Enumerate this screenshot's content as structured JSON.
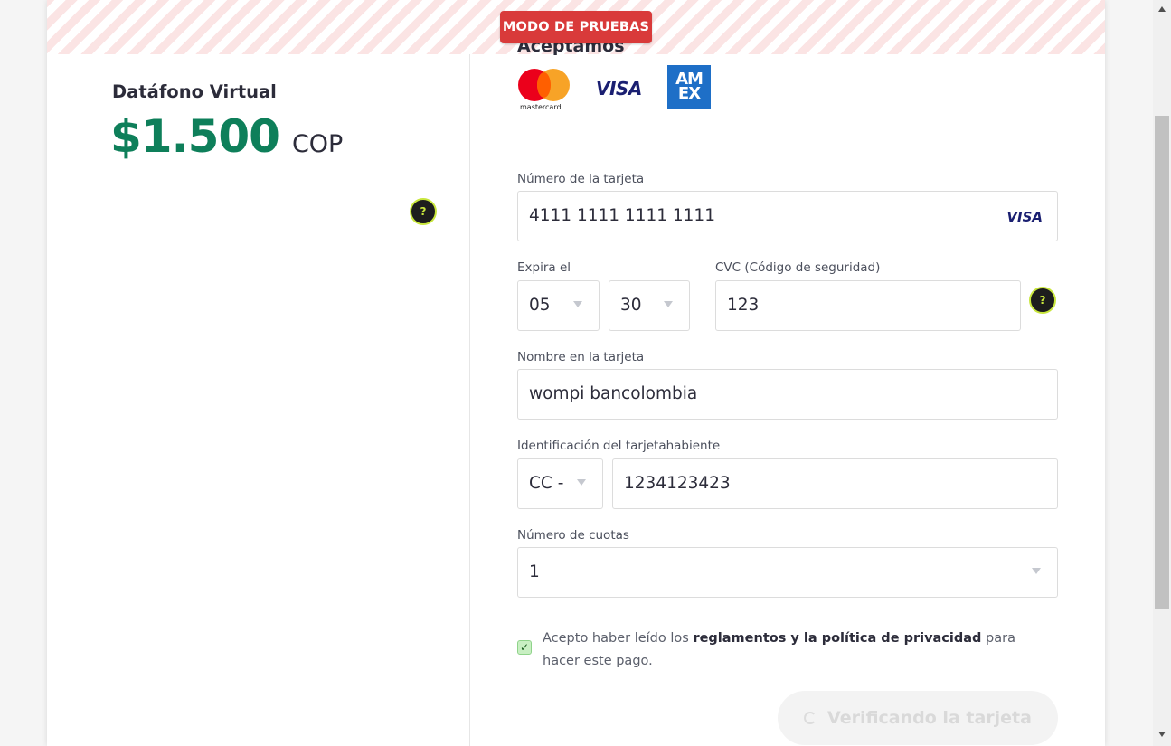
{
  "banner": {
    "test_mode_label": "MODO DE PRUEBAS"
  },
  "summary": {
    "merchant_name": "Datáfono Virtual",
    "amount": "$1.500",
    "currency": "COP",
    "help_icon": "question-mark"
  },
  "accepted": {
    "title": "Aceptamos",
    "brands": [
      {
        "name": "mastercard",
        "label": "mastercard",
        "icon": "mastercard-logo"
      },
      {
        "name": "visa",
        "label": "VISA",
        "icon": "visa-logo"
      },
      {
        "name": "amex",
        "label": "AM EX",
        "icon": "amex-logo"
      }
    ]
  },
  "form": {
    "card_number": {
      "label": "Número de la tarjeta",
      "value": "4111 1111 1111 1111",
      "brand_label": "VISA"
    },
    "expiry": {
      "label": "Expira el",
      "month": "05",
      "year": "30"
    },
    "cvc": {
      "label": "CVC (Código de seguridad)",
      "value": "123"
    },
    "name": {
      "label": "Nombre en la tarjeta",
      "value": "wompi bancolombia"
    },
    "identification": {
      "label": "Identificación del tarjetahabiente",
      "type": "CC -",
      "value": "1234123423"
    },
    "installments": {
      "label": "Número de cuotas",
      "value": "1"
    },
    "terms": {
      "checked": true,
      "prefix": "Acepto haber leído los ",
      "link": "reglamentos y la política de privacidad",
      "suffix": " para hacer este pago."
    },
    "submit_label": "Verificando la tarjeta"
  },
  "colors": {
    "accent_green": "#0e7f5a",
    "test_badge_red": "#d93a3a",
    "help_ring": "#c8e63c"
  }
}
